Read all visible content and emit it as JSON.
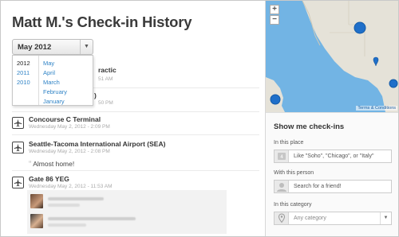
{
  "page": {
    "title": "Matt M.'s Check-in History"
  },
  "month_picker": {
    "selected": "May 2012",
    "years": [
      "2012",
      "2011",
      "2010"
    ],
    "months": [
      "May",
      "April",
      "March",
      "February",
      "January"
    ]
  },
  "checkins_partial": [
    {
      "name_tail": "ractic",
      "time_tail": "51 AM"
    },
    {
      "name_tail": ")",
      "time_tail": "50 PM"
    }
  ],
  "checkins": [
    {
      "name": "Concourse C Terminal",
      "time": "Wednesday May 2, 2012 - 2:09 PM"
    },
    {
      "name": "Seattle-Tacoma International Airport (SEA)",
      "time": "Wednesday May 2, 2012 - 2:08 PM",
      "shout": "Almost home!"
    },
    {
      "name": "Gate 86 YEG",
      "time": "Wednesday May 2, 2012 - 11:53 AM"
    }
  ],
  "map": {
    "zoom_in": "+",
    "zoom_out": "−",
    "terms": "Terms & Conditions"
  },
  "filters": {
    "heading": "Show me check-ins",
    "place_label": "In this place",
    "place_placeholder": "Like \"Soho\", \"Chicago\", or \"Italy\"",
    "person_label": "With this person",
    "person_placeholder": "Search for a friend!",
    "category_label": "In this category",
    "category_value": "Any category"
  }
}
